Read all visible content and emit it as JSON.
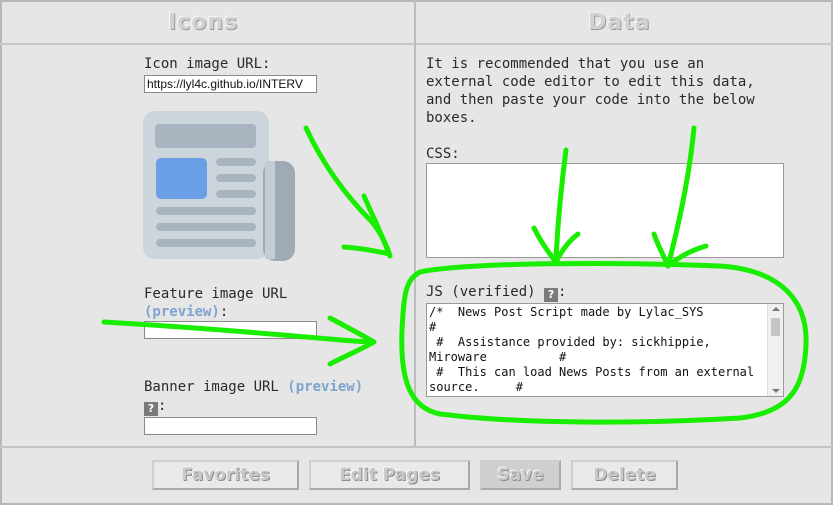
{
  "columns": {
    "icons_title": "Icons",
    "data_title": "Data"
  },
  "icons": {
    "icon_url_label": "Icon image URL:",
    "icon_url_value": "https://lyl4c.github.io/INTERV",
    "feature_url_label": "Feature image URL",
    "feature_preview": "(preview)",
    "feature_colon": ":",
    "feature_url_value": "",
    "banner_url_label": "Banner image URL",
    "banner_preview": "(preview)",
    "banner_colon": ":",
    "banner_url_value": "",
    "help_glyph": "?"
  },
  "data_panel": {
    "description": "It is recommended that you use an\nexternal code editor to edit this data,\nand then paste your code into the below\nboxes.",
    "css_label": "CSS:",
    "css_value": "",
    "js_label": "JS (verified)",
    "js_colon": ":",
    "js_value": "/*  News Post Script made by Lylac_SYS\n#\n #  Assistance provided by: sickhippie,\nMiroware          #\n #  This can load News Posts from an external\nsource.     #"
  },
  "buttons": {
    "favorites": "Favorites",
    "edit_pages": "Edit Pages",
    "save": "Save",
    "delete": "Delete"
  },
  "colors": {
    "annotation_green": "#1aee00",
    "preview_link": "#7ea4cf",
    "newspaper_blue": "#6a9fe6",
    "newspaper_gray": "#a8b4bf"
  },
  "icon_names": [
    "newspaper-icon",
    "help-icon"
  ]
}
